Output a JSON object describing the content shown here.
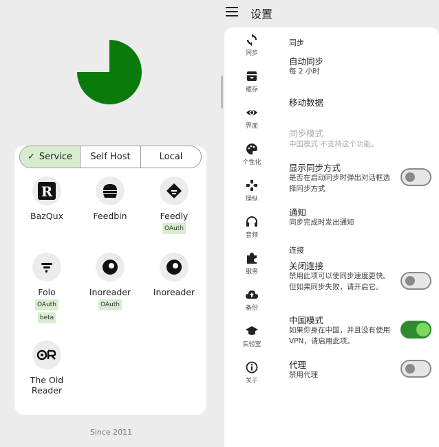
{
  "left": {
    "segments": [
      {
        "label": "Service",
        "active": true
      },
      {
        "label": "Self Host",
        "active": false
      },
      {
        "label": "Local",
        "active": false
      }
    ],
    "services": [
      {
        "name": "BazQux",
        "icon": "bazqux-icon",
        "tags": []
      },
      {
        "name": "Feedbin",
        "icon": "feedbin-icon",
        "tags": []
      },
      {
        "name": "Feedly",
        "icon": "feedly-icon",
        "tags": [
          "OAuth"
        ]
      },
      {
        "name": "Folo",
        "icon": "folo-icon",
        "tags": [
          "OAuth",
          "beta"
        ]
      },
      {
        "name": "Inoreader",
        "icon": "inoreader-icon",
        "tags": [
          "OAuth"
        ]
      },
      {
        "name": "Inoreader",
        "icon": "inoreader-icon",
        "tags": []
      },
      {
        "name": "The Old\nReader",
        "icon": "theoldreader-icon",
        "tags": []
      }
    ],
    "footer": "Since 2011",
    "accent": "#0a7a0a"
  },
  "right": {
    "title": "设置",
    "nav": [
      {
        "label": "同步",
        "icon": "sync-icon"
      },
      {
        "label": "缓存",
        "icon": "archive-icon"
      },
      {
        "label": "界面",
        "icon": "eye-icon"
      },
      {
        "label": "个性化",
        "icon": "palette-icon"
      },
      {
        "label": "操纵",
        "icon": "gamepad-icon"
      },
      {
        "label": "音频",
        "icon": "headphones-icon"
      },
      {
        "label": "服务",
        "icon": "puzzle-icon"
      },
      {
        "label": "备份",
        "icon": "cloud-upload-icon"
      },
      {
        "label": "实验室",
        "icon": "graduation-cap-icon"
      },
      {
        "label": "关于",
        "icon": "info-icon"
      }
    ],
    "sync_section": "同步",
    "auto_sync": {
      "title": "自动同步",
      "sub": "每 2 小时"
    },
    "mobile_data": {
      "title": "移动数据"
    },
    "sync_mode": {
      "title": "同步模式",
      "sub": "中国模式 不支持这个功能。"
    },
    "show_sync": {
      "title": "显示同步方式",
      "sub": "是否在启动同步时弹出对话框选择同步方式",
      "on": false
    },
    "notify": {
      "title": "通知",
      "sub": "同步完成时发出通知"
    },
    "conn_section": "连接",
    "close_conn": {
      "title": "关闭连接",
      "sub": "禁用此项可以使同步速度更快。但如果同步失败，请开启它。",
      "on": false
    },
    "china_mode": {
      "title": "中国模式",
      "sub": "如果你身在中国，并且没有使用 VPN，请启用此项。",
      "on": true
    },
    "proxy": {
      "title": "代理",
      "sub": "禁用代理",
      "on": false
    },
    "toggle_on_color": "#2e8a2e"
  }
}
